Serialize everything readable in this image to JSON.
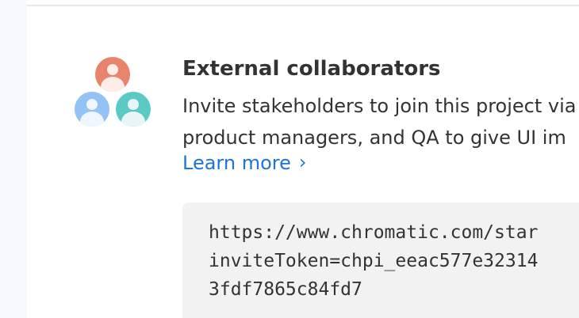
{
  "colors": {
    "avatar_top": "#e8846b",
    "avatar_left": "#93c3f5",
    "avatar_right": "#5ccac4",
    "link": "#1e73d9",
    "text": "#333333",
    "code_bg": "#f2f2f2"
  },
  "section": {
    "title": "External collaborators",
    "description_lines": [
      "Invite stakeholders to join this project via",
      "product managers, and QA to give UI im"
    ],
    "learn_more_label": "Learn more",
    "learn_more_icon": "chevron-right-icon",
    "invite_link_lines": [
      "https://www.chromatic.com/star",
      "inviteToken=chpi_eeac577e32314",
      "3fdf7865c84fd7"
    ]
  },
  "avatars": [
    {
      "name": "user-icon",
      "color": "#e8846b"
    },
    {
      "name": "user-icon",
      "color": "#93c3f5"
    },
    {
      "name": "user-icon",
      "color": "#5ccac4"
    }
  ]
}
